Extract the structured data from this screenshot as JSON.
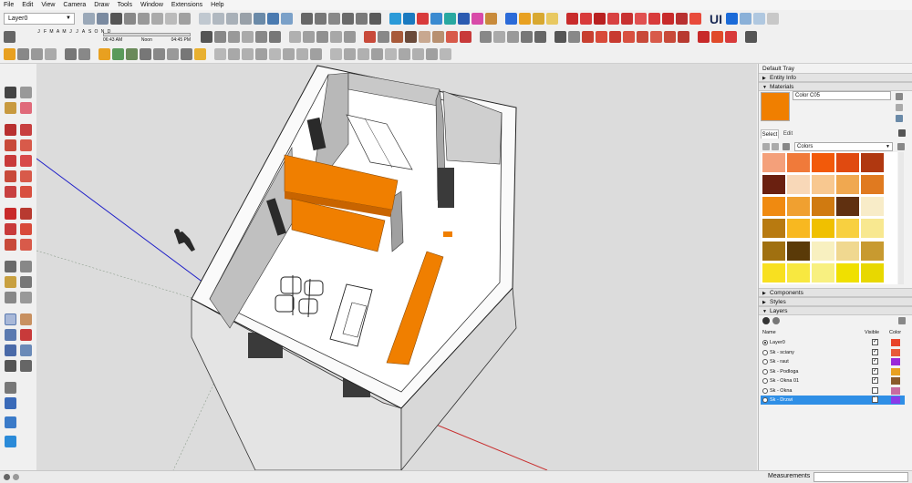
{
  "menu": [
    "File",
    "Edit",
    "View",
    "Camera",
    "Draw",
    "Tools",
    "Window",
    "Extensions",
    "Help"
  ],
  "toolbar": {
    "layer_value": "Layer0",
    "months": [
      "J",
      "F",
      "M",
      "A",
      "M",
      "J",
      "J",
      "A",
      "S",
      "O",
      "N",
      "D"
    ],
    "time_start": "06:43 AM",
    "time_noon": "Noon",
    "time_end": "04:45 PM",
    "ui_label": "UI"
  },
  "tray": {
    "title": "Default Tray",
    "entity_info": "Entity Info",
    "materials": "Materials",
    "material_name": "Color C05",
    "material_color": "#f07f00",
    "tab_select": "Select",
    "tab_edit": "Edit",
    "collection": "Colors",
    "swatches": [
      "#f4a07a",
      "#f07a3a",
      "#f25a0a",
      "#e04a10",
      "#b03810",
      "#6a2010",
      "#f8d8b8",
      "#f8c890",
      "#f0a850",
      "#e07a20",
      "#f08a10",
      "#f0a030",
      "#d07a10",
      "#603010",
      "#f8ecc8",
      "#b87a10",
      "#f8b820",
      "#f0c000",
      "#f8d040",
      "#f8e890",
      "#a07010",
      "#5a3a08",
      "#f8f0c0",
      "#f0d890",
      "#c89a30",
      "#f8e020",
      "#f8e840",
      "#f8f080",
      "#f0e000",
      "#e8d800"
    ],
    "components": "Components",
    "styles": "Styles",
    "layers": "Layers",
    "layer_col_name": "Name",
    "layer_col_visible": "Visible",
    "layer_col_color": "Color",
    "layers_list": [
      {
        "name": "Layer0",
        "active": true,
        "visible": true,
        "color": "#e8442a"
      },
      {
        "name": "Sk - sciany",
        "active": false,
        "visible": true,
        "color": "#e85a3a"
      },
      {
        "name": "Sk - raut",
        "active": false,
        "visible": true,
        "color": "#9a2ad8"
      },
      {
        "name": "Sk - Podloga",
        "active": false,
        "visible": true,
        "color": "#e8a020"
      },
      {
        "name": "Sk - Okna 01",
        "active": false,
        "visible": true,
        "color": "#8a5a2a"
      },
      {
        "name": "Sk - Okna",
        "active": false,
        "visible": false,
        "color": "#c86aa0"
      },
      {
        "name": "Sk - Drzwi",
        "active": false,
        "visible": true,
        "color": "#8a3ae8",
        "selected": true
      }
    ]
  },
  "status": {
    "measurements_label": "Measurements",
    "measurements_value": ""
  }
}
